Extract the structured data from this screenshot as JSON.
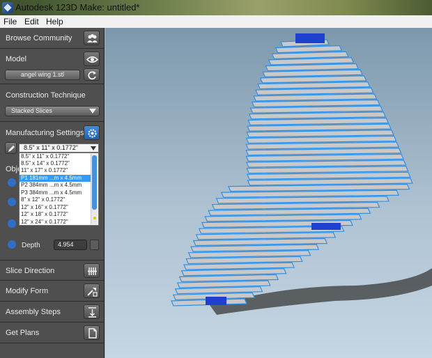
{
  "window": {
    "title": "Autodesk 123D Make: untitled*"
  },
  "menu": [
    {
      "label": "File"
    },
    {
      "label": "Edit"
    },
    {
      "label": "Help"
    }
  ],
  "sidebar": {
    "browse": {
      "label": "Browse Community",
      "icon": "community-icon"
    },
    "model": {
      "label": "Model",
      "icon": "eye-icon",
      "file": "angel wing 1.stl",
      "refresh_icon": "refresh-icon"
    },
    "construction": {
      "label": "Construction Technique",
      "value": "Stacked Slices"
    },
    "manufacturing": {
      "label": "Manufacturing Settings",
      "icon": "gear-icon",
      "selected": "8.5\" x 11\" x 0.1772\"",
      "options": [
        "8.5\" x 11\" x 0.1772\"",
        "8.5\" x 14\" x 0.1772\"",
        "11\" x 17\" x 0.1772\"",
        "P1 181mm ...m x 4.5mm",
        "P2 384mm ...m x 4.5mm",
        "P3 384mm ...m x 4.5mm",
        "8\" x 12\" x 0.1772\"",
        "12\" x 16\" x 0.1772\"",
        "12\" x 18\" x 0.1772\"",
        "12\" x 24\" x 0.1772\""
      ],
      "highlighted_index": 3
    },
    "object": {
      "label_partial": "Obje",
      "depth_label": "Depth",
      "depth_value": "4.954"
    },
    "slice_direction": {
      "label": "Slice Direction",
      "icon": "slice-direction-icon"
    },
    "modify_form": {
      "label": "Modify Form",
      "icon": "modify-form-icon"
    },
    "assembly_steps": {
      "label": "Assembly Steps",
      "icon": "assembly-steps-icon"
    },
    "get_plans": {
      "label": "Get Plans",
      "icon": "get-plans-icon"
    }
  },
  "colors": {
    "slice_edge": "#2f8fe6",
    "slice_body": "#c9c9c9",
    "selection": "#3399ff",
    "sidebar_bg": "#4f4f4f",
    "accent": "#1f3fcf"
  }
}
